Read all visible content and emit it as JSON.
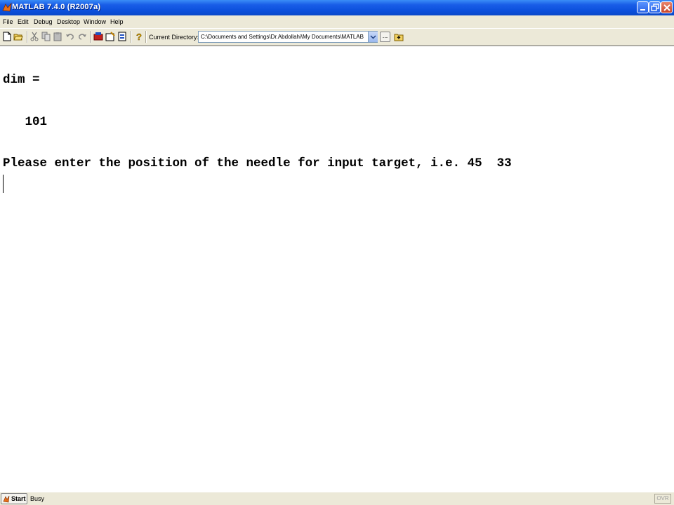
{
  "window": {
    "title": "MATLAB  7.4.0 (R2007a)",
    "title_bar_color": "#0b4fdc",
    "icon": "matlab-membrane-icon"
  },
  "menu": [
    "File",
    "Edit",
    "Debug",
    "Desktop",
    "Window",
    "Help"
  ],
  "toolbar": {
    "buttons": [
      "new-file-icon",
      "open-folder-icon",
      "cut-icon",
      "copy-icon",
      "paste-icon",
      "undo-icon",
      "redo-icon",
      "simulink-icon",
      "guide-icon",
      "profiler-icon",
      "help-icon"
    ],
    "current_directory_label": "Current Directory:",
    "current_directory_value": "C:\\Documents and Settings\\Dr.Abdollahi\\My Documents\\MATLAB",
    "browse_label": "..."
  },
  "command_window": {
    "lines": [
      "dim =",
      "   101",
      "Please enter the position of the needle for input target, i.e. 45  33"
    ]
  },
  "statusbar": {
    "start_label": "Start",
    "status_text": "Busy",
    "ovr_label": "OVR"
  }
}
